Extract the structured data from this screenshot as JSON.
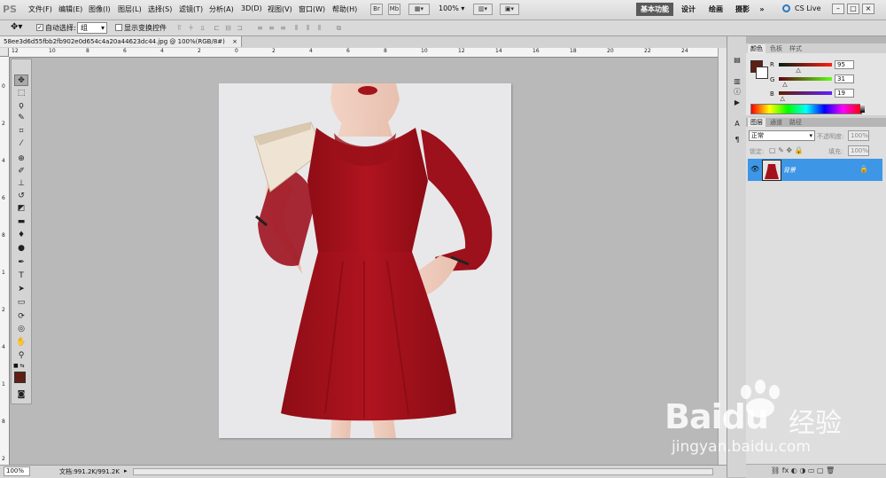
{
  "app": {
    "logo": "PS"
  },
  "menu": [
    "文件(F)",
    "编辑(E)",
    "图像(I)",
    "图层(L)",
    "选择(S)",
    "滤镜(T)",
    "分析(A)",
    "3D(D)",
    "视图(V)",
    "窗口(W)",
    "帮助(H)"
  ],
  "menubar_tools": {
    "zoom": "100%"
  },
  "workspaces": [
    "基本功能",
    "设计",
    "绘画",
    "摄影",
    "»"
  ],
  "cslive": "CS Live",
  "window_buttons": [
    "–",
    "□",
    "×"
  ],
  "options": {
    "auto_select_label": "自动选择:",
    "auto_select_value": "组",
    "show_transform_label": "显示变换控件"
  },
  "document": {
    "tab_title": "58ee3d6d55fbb2fb902e0d654c4a20a44623dc44.jpg @ 100%(RGB/8#)",
    "close": "×"
  },
  "rulers": {
    "top": [
      "12",
      "10",
      "8",
      "6",
      "4",
      "2",
      "0",
      "2",
      "4",
      "6",
      "8",
      "10",
      "12",
      "14",
      "16",
      "18",
      "20",
      "22",
      "24"
    ],
    "left": [
      "0",
      "2",
      "4",
      "6",
      "8",
      "1",
      "2",
      "4",
      "1",
      "8",
      "2"
    ]
  },
  "status": {
    "zoom": "100%",
    "doc": "文档:991.2K/991.2K"
  },
  "color_panel": {
    "tabs": [
      "颜色",
      "色板",
      "样式"
    ],
    "r_label": "R",
    "g_label": "G",
    "b_label": "B",
    "r": "95",
    "g": "31",
    "b": "19"
  },
  "layers_panel": {
    "tabs": [
      "图层",
      "通道",
      "路径"
    ],
    "blend_mode": "正常",
    "opacity_label": "不透明度:",
    "opacity": "100%",
    "lock_label": "锁定:",
    "fill_label": "填充:",
    "fill": "100%",
    "layer_name": "背景"
  },
  "watermark": {
    "brand": "Baidu",
    "cn": "经验",
    "url": "jingyan.baidu.com"
  },
  "colors": {
    "foreground": "#5f1f13",
    "accent_blue": "#3d96e6",
    "dress_red": "#a4121b"
  }
}
